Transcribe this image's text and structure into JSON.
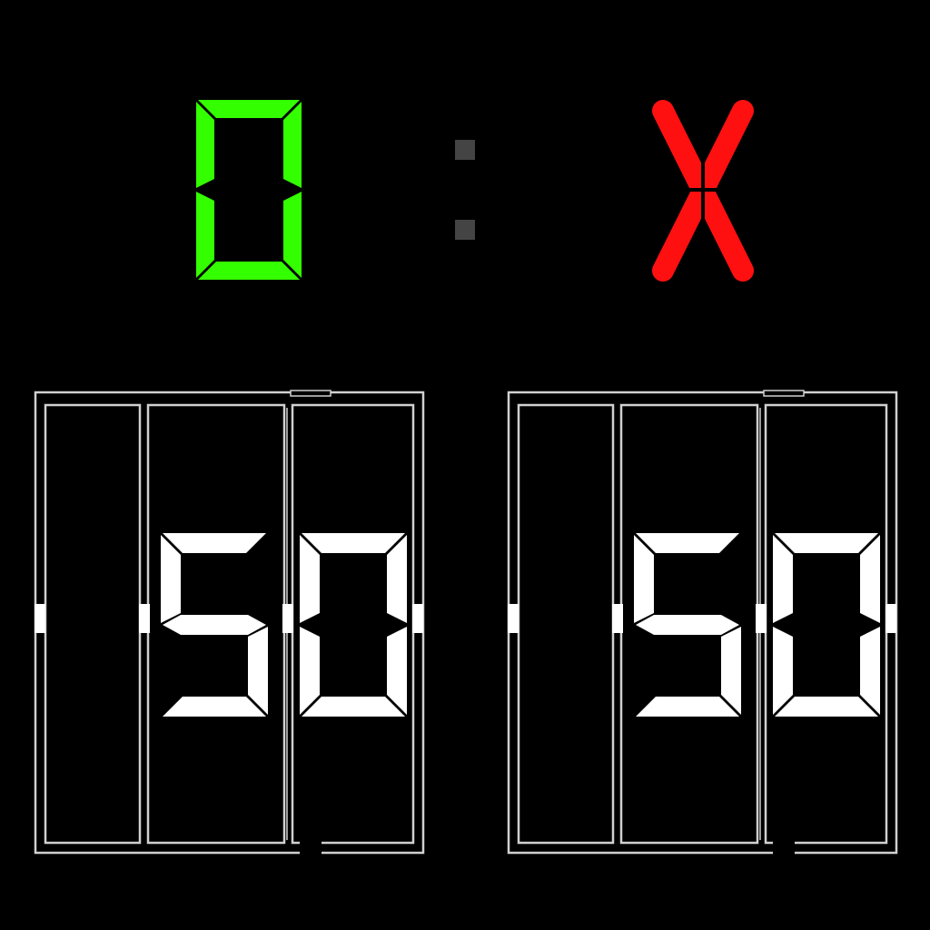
{
  "scoreboard": {
    "left_score": "0",
    "separator": ":",
    "right_score": "X"
  },
  "panels": [
    {
      "name": "left-panel",
      "reading": "50"
    },
    {
      "name": "right-panel",
      "reading": "50"
    }
  ],
  "colors": {
    "background": "#000000",
    "left_score_color": "#33ff00",
    "right_score_color": "#ff1010",
    "separator_color": "#444444",
    "panel_line_color": "#d0d0d0",
    "panel_digit_color": "#ffffff"
  }
}
